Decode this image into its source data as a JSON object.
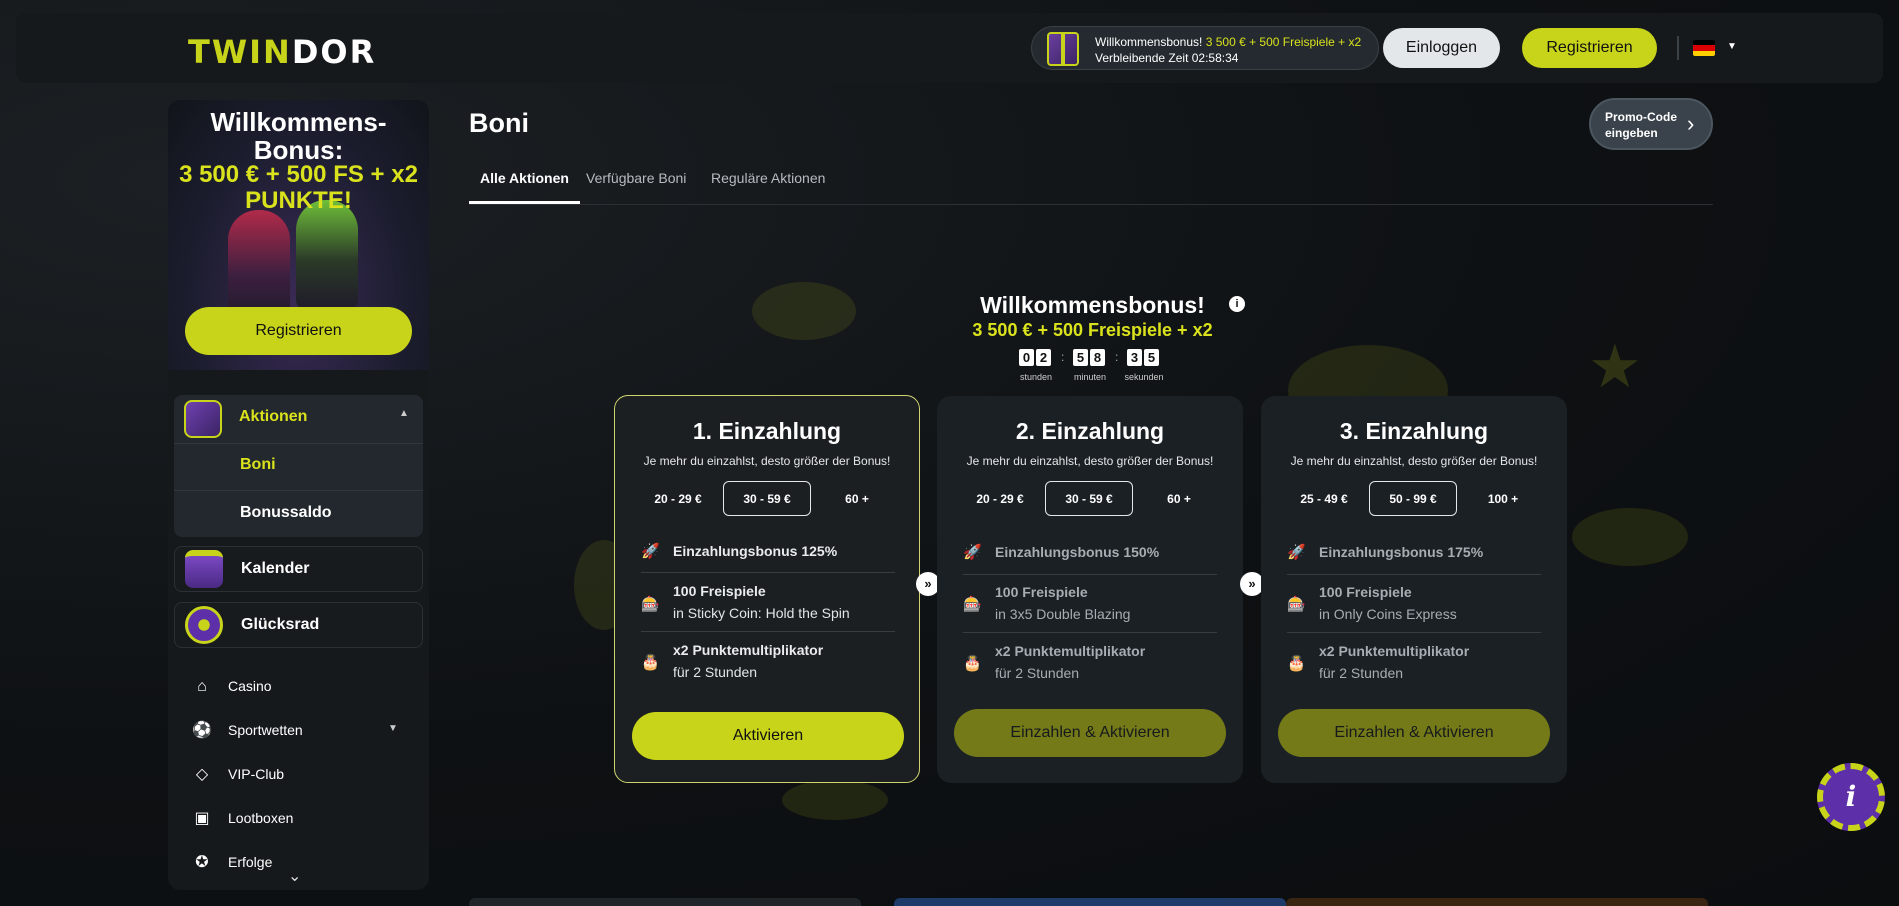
{
  "header": {
    "logo_part1": "TWIN",
    "logo_part2": "DOR",
    "bonus_label": "Willkommensbonus!",
    "bonus_highlight": "3 500 € + 500 Freispiele + x2",
    "bonus_timer": "Verbleibende Zeit 02:58:34",
    "login_label": "Einloggen",
    "register_label": "Registrieren",
    "language_icon": "german-flag-icon"
  },
  "sidebar": {
    "promo_title": "Willkommens-\nBonus:",
    "promo_amount": "3 500 € + 500 FS + x2 PUNKTE!",
    "register_label": "Registrieren",
    "aktionen_label": "Aktionen",
    "sub_items": [
      "Boni",
      "Bonussaldo"
    ],
    "boxes": [
      "Kalender",
      "Glücksrad"
    ],
    "nav": [
      {
        "label": "Casino",
        "icon": "home-icon"
      },
      {
        "label": "Sportwetten",
        "icon": "soccer-icon"
      },
      {
        "label": "VIP-Club",
        "icon": "diamond-icon"
      },
      {
        "label": "Lootboxen",
        "icon": "lootbox-icon"
      },
      {
        "label": "Erfolge",
        "icon": "medal-icon"
      }
    ]
  },
  "main": {
    "title": "Boni",
    "promo_code_label": "Promo-Code eingeben",
    "tabs": [
      "Alle Aktionen",
      "Verfügbare Boni",
      "Reguläre Aktionen"
    ],
    "welcome_title": "Willkommensbonus!",
    "welcome_sub": "3 500 € + 500 Freispiele + x2",
    "timer": {
      "digits": [
        "0",
        "2",
        "5",
        "8",
        "3",
        "5"
      ],
      "labels": [
        "stunden",
        "minuten",
        "sekunden"
      ]
    },
    "cards": [
      {
        "title": "1. Einzahlung",
        "subtitle": "Je mehr du einzahlst, desto größer der Bonus!",
        "ranges": [
          "20 - 29 €",
          "30 - 59 €",
          "60 +"
        ],
        "f1": "Einzahlungsbonus 125%",
        "f2": "100 Freispiele",
        "f2_sub": "in Sticky Coin: Hold the Spin",
        "f3": "x2 Punktemultiplikator",
        "f3_sub": "für 2 Stunden",
        "button": "Aktivieren"
      },
      {
        "title": "2. Einzahlung",
        "subtitle": "Je mehr du einzahlst, desto größer der Bonus!",
        "ranges": [
          "20 - 29 €",
          "30 - 59 €",
          "60 +"
        ],
        "f1": "Einzahlungsbonus 150%",
        "f2": "100 Freispiele",
        "f2_sub": "in 3x5 Double Blazing",
        "f3": "x2 Punktemultiplikator",
        "f3_sub": "für 2 Stunden",
        "button": "Einzahlen & Aktivieren"
      },
      {
        "title": "3. Einzahlung",
        "subtitle": "Je mehr du einzahlst, desto größer der Bonus!",
        "ranges": [
          "25 - 49 €",
          "50 - 99 €",
          "100 +"
        ],
        "f1": "Einzahlungsbonus 175%",
        "f2": "100 Freispiele",
        "f2_sub": "in Only Coins Express",
        "f3": "x2 Punktemultiplikator",
        "f3_sub": "für 2 Stunden",
        "button": "Einzahlen & Aktivieren"
      }
    ]
  },
  "colors": {
    "accent": "#c8d41a",
    "accent_text": "#d9e21c",
    "muted_button": "#747a18",
    "card_bg": "#1b2024",
    "background": "#0e1113"
  }
}
